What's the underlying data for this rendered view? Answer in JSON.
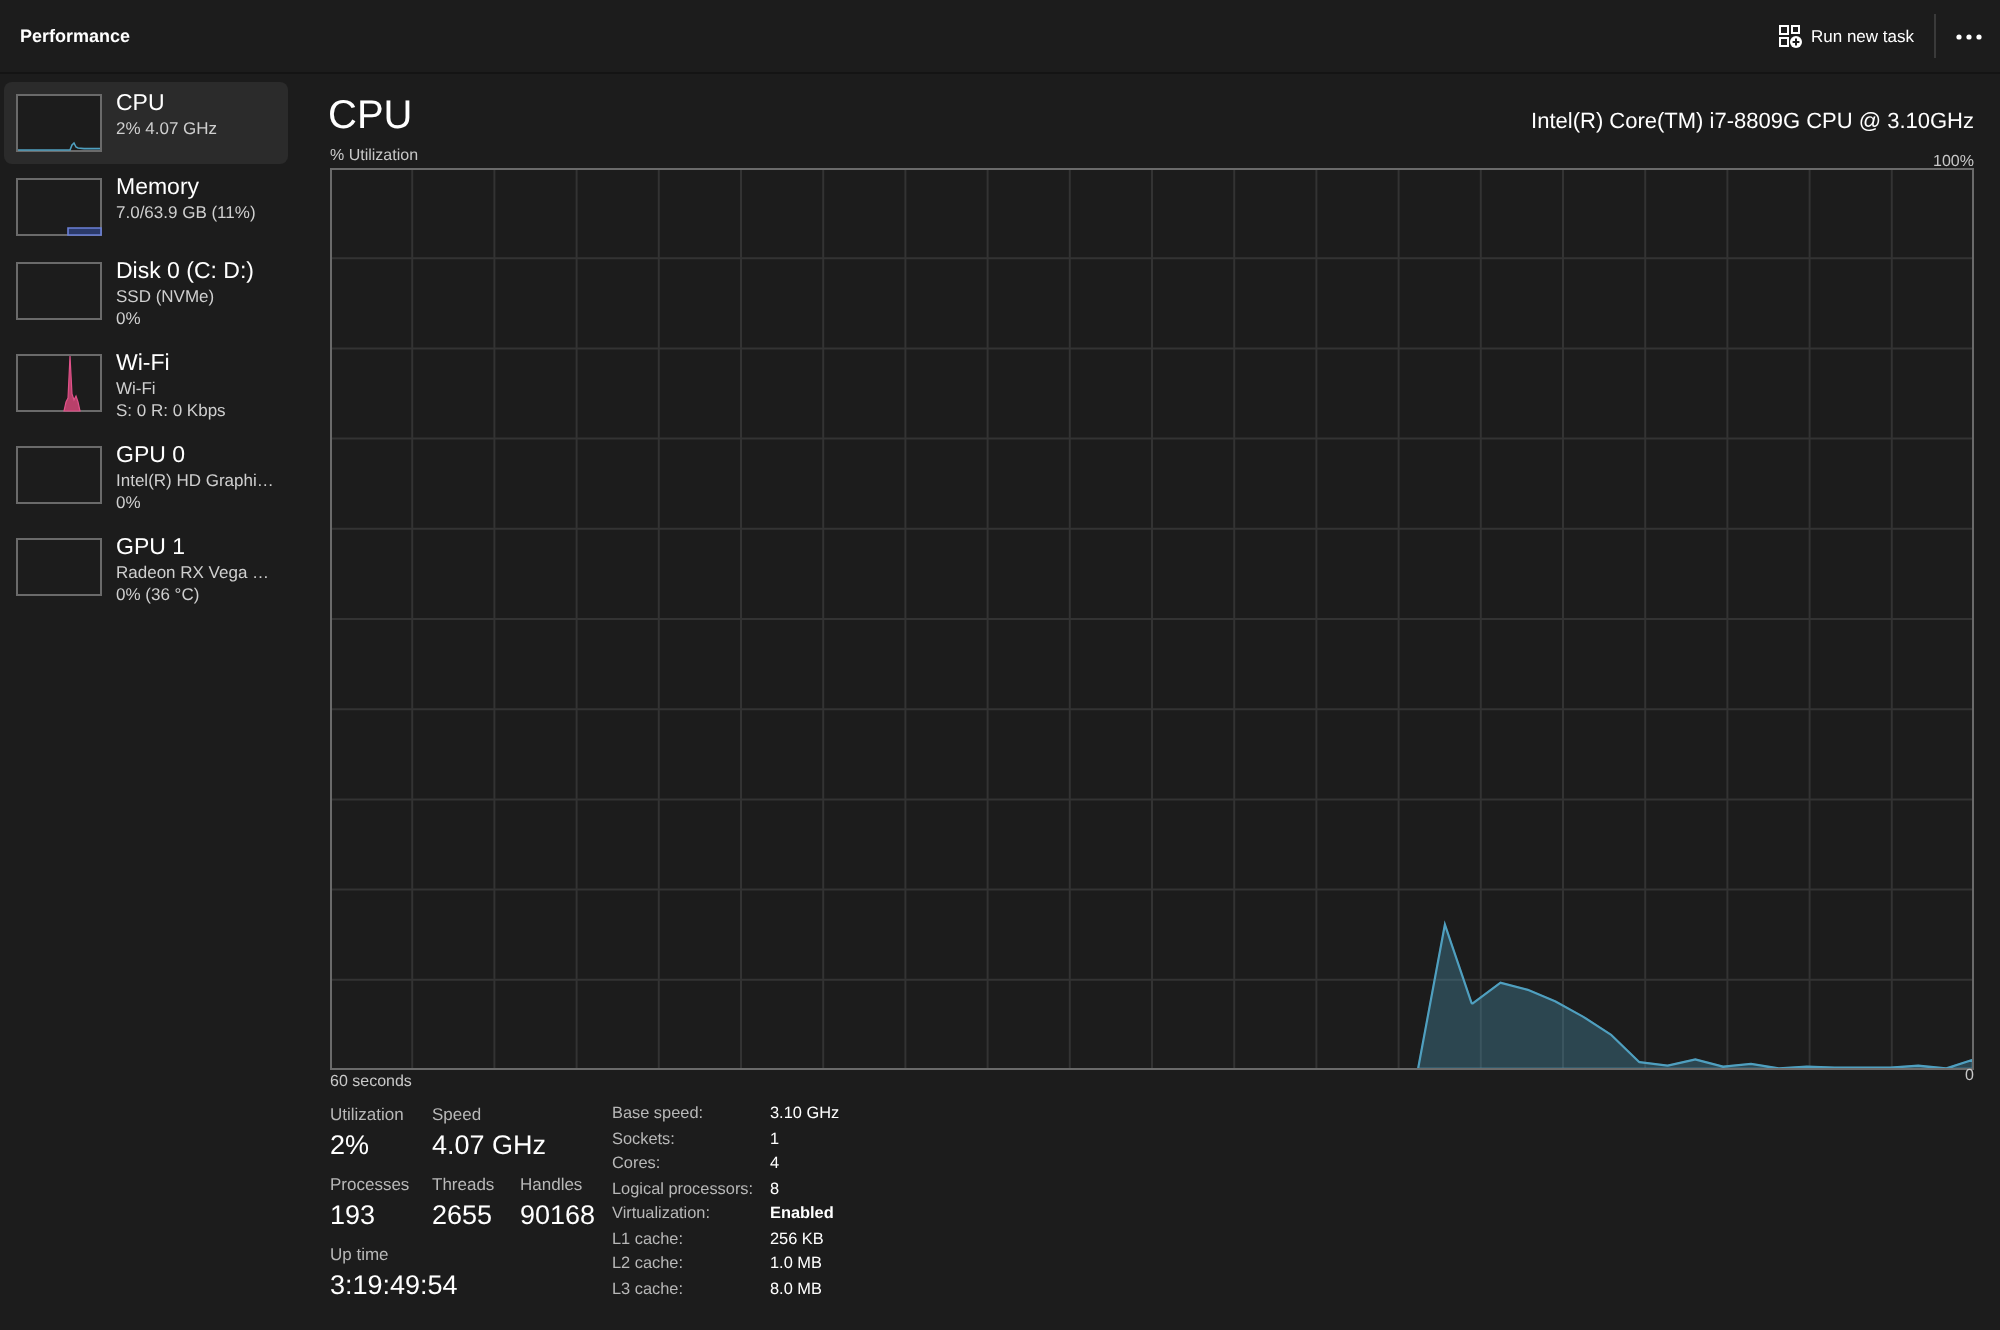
{
  "window": {
    "title": "Performance"
  },
  "toolbar": {
    "run_new_task": "Run new task"
  },
  "sidebar": {
    "items": [
      {
        "kind": "cpu",
        "name": "CPU",
        "details": [
          "2% 4.07 GHz"
        ],
        "selected": true
      },
      {
        "kind": "memory",
        "name": "Memory",
        "details": [
          "7.0/63.9 GB (11%)"
        ],
        "selected": false
      },
      {
        "kind": "disk",
        "name": "Disk 0 (C: D:)",
        "details": [
          "SSD (NVMe)",
          "0%"
        ],
        "selected": false
      },
      {
        "kind": "network",
        "name": "Wi-Fi",
        "details": [
          "Wi-Fi",
          "S: 0 R: 0 Kbps"
        ],
        "selected": false
      },
      {
        "kind": "gpu",
        "name": "GPU 0",
        "details": [
          "Intel(R) HD Graphi…",
          "0%"
        ],
        "selected": false
      },
      {
        "kind": "gpu",
        "name": "GPU 1",
        "details": [
          "Radeon RX Vega …",
          "0% (36 °C)"
        ],
        "selected": false
      }
    ]
  },
  "detail": {
    "title": "CPU",
    "processor": "Intel(R) Core(TM) i7-8809G CPU @ 3.10GHz",
    "chart_data": {
      "type": "area",
      "ylabel": "% Utilization",
      "xlabel": "60 seconds",
      "grid": true,
      "categories": [
        null,
        null,
        null,
        null,
        null,
        null,
        null,
        null,
        null,
        null,
        null,
        null,
        null,
        null,
        null,
        null,
        null,
        null,
        null,
        null,
        null,
        null,
        null,
        null,
        null,
        null,
        null,
        null,
        null,
        null,
        null,
        null,
        null,
        null,
        null,
        null,
        null,
        null,
        null,
        null,
        null,
        null,
        null,
        null,
        null,
        null,
        null,
        null,
        null,
        null,
        null,
        null,
        null,
        null,
        null,
        null,
        null,
        null,
        null,
        null
      ],
      "series": [
        {
          "color": "#4f9fbf",
          "values": [
            null,
            null,
            null,
            null,
            null,
            null,
            null,
            null,
            null,
            null,
            null,
            null,
            null,
            null,
            null,
            null,
            null,
            null,
            null,
            null,
            null,
            null,
            null,
            null,
            null,
            null,
            null,
            null,
            null,
            null,
            null,
            null,
            null,
            null,
            null,
            null,
            null,
            null,
            null,
            0,
            16.6,
            7.5,
            9.8,
            9,
            7.7,
            6,
            4,
            1,
            0.6,
            1.3,
            0.5,
            0.8,
            0.3,
            0.5,
            0.4,
            0.4,
            0.4,
            0.6,
            0.3,
            1.3
          ]
        }
      ],
      "ylim": [
        0,
        100
      ],
      "yticks": [
        {
          "value": 0,
          "label": "0"
        },
        {
          "value": 100,
          "label": "100%"
        }
      ]
    },
    "stats": [
      [
        {
          "label": "Utilization",
          "value": "2%"
        },
        {
          "label": "Speed",
          "value": "4.07 GHz"
        }
      ],
      [
        {
          "label": "Processes",
          "value": "193"
        },
        {
          "label": "Threads",
          "value": "2655"
        },
        {
          "label": "Handles",
          "value": "90168"
        }
      ],
      [
        {
          "label": "Up time",
          "value": "3:19:49:54"
        }
      ]
    ],
    "specs": [
      {
        "label": "Base speed:",
        "value": "3.10 GHz",
        "bold": false
      },
      {
        "label": "Sockets:",
        "value": "1",
        "bold": false
      },
      {
        "label": "Cores:",
        "value": "4",
        "bold": false
      },
      {
        "label": "Logical processors:",
        "value": "8",
        "bold": false
      },
      {
        "label": "Virtualization:",
        "value": "Enabled",
        "bold": true
      },
      {
        "label": "L1 cache:",
        "value": "256 KB",
        "bold": false
      },
      {
        "label": "L2 cache:",
        "value": "1.0 MB",
        "bold": false
      },
      {
        "label": "L3 cache:",
        "value": "8.0 MB",
        "bold": false
      }
    ]
  }
}
